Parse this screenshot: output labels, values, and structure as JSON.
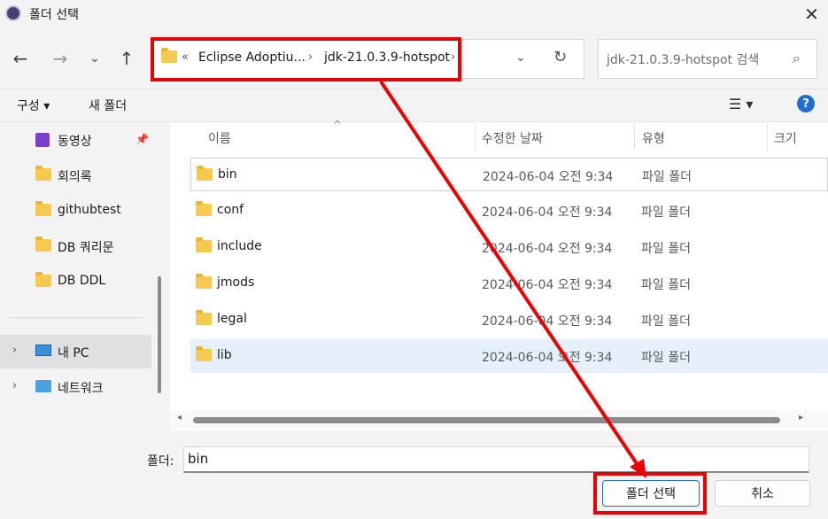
{
  "window": {
    "title": "폴더 선택",
    "close_glyph": "✕"
  },
  "nav_buttons": {
    "back": "←",
    "forward": "→",
    "recent": "⌄",
    "up": "↑"
  },
  "address": {
    "overflow": "«",
    "breadcrumbs": [
      "Eclipse Adoptiu...",
      "jdk-21.0.3.9-hotspot"
    ],
    "separator": "›",
    "dropdown": "⌄",
    "refresh": "↻"
  },
  "search": {
    "placeholder": "jdk-21.0.3.9-hotspot 검색",
    "icon": "⌕"
  },
  "toolbar": {
    "organize": "구성 ▾",
    "new_folder": "새 폴더",
    "view": "☰ ▾",
    "help": "?"
  },
  "sidebar": {
    "items": [
      {
        "label": "동영상",
        "icon": "video-icon",
        "pinned": true
      },
      {
        "label": "회의록",
        "icon": "folder-icon"
      },
      {
        "label": "githubtest",
        "icon": "folder-icon"
      },
      {
        "label": "DB 쿼리문",
        "icon": "folder-icon"
      },
      {
        "label": "DB DDL",
        "icon": "folder-icon"
      }
    ],
    "sections": [
      {
        "label": "내 PC",
        "icon": "pc-icon",
        "selected": true
      },
      {
        "label": "네트워크",
        "icon": "network-icon"
      }
    ],
    "expand_glyph": "›"
  },
  "columns": {
    "name": "이름",
    "date": "수정한 날짜",
    "type": "유형",
    "size": "크기",
    "sort_glyph": "^"
  },
  "files": [
    {
      "name": "bin",
      "date": "2024-06-04 오전 9:34",
      "type": "파일 폴더"
    },
    {
      "name": "conf",
      "date": "2024-06-04 오전 9:34",
      "type": "파일 폴더"
    },
    {
      "name": "include",
      "date": "2024-06-04 오전 9:34",
      "type": "파일 폴더"
    },
    {
      "name": "jmods",
      "date": "2024-06-04 오전 9:34",
      "type": "파일 폴더"
    },
    {
      "name": "legal",
      "date": "2024-06-04 오전 9:34",
      "type": "파일 폴더"
    },
    {
      "name": "lib",
      "date": "2024-06-04 오전 9:34",
      "type": "파일 폴더"
    }
  ],
  "hscroll": {
    "left": "◂",
    "right": "▸"
  },
  "footer": {
    "folder_label": "폴더:",
    "folder_value": "bin",
    "select_button": "폴더 선택",
    "cancel_button": "취소"
  },
  "annotation": {
    "color": "#e80000"
  }
}
